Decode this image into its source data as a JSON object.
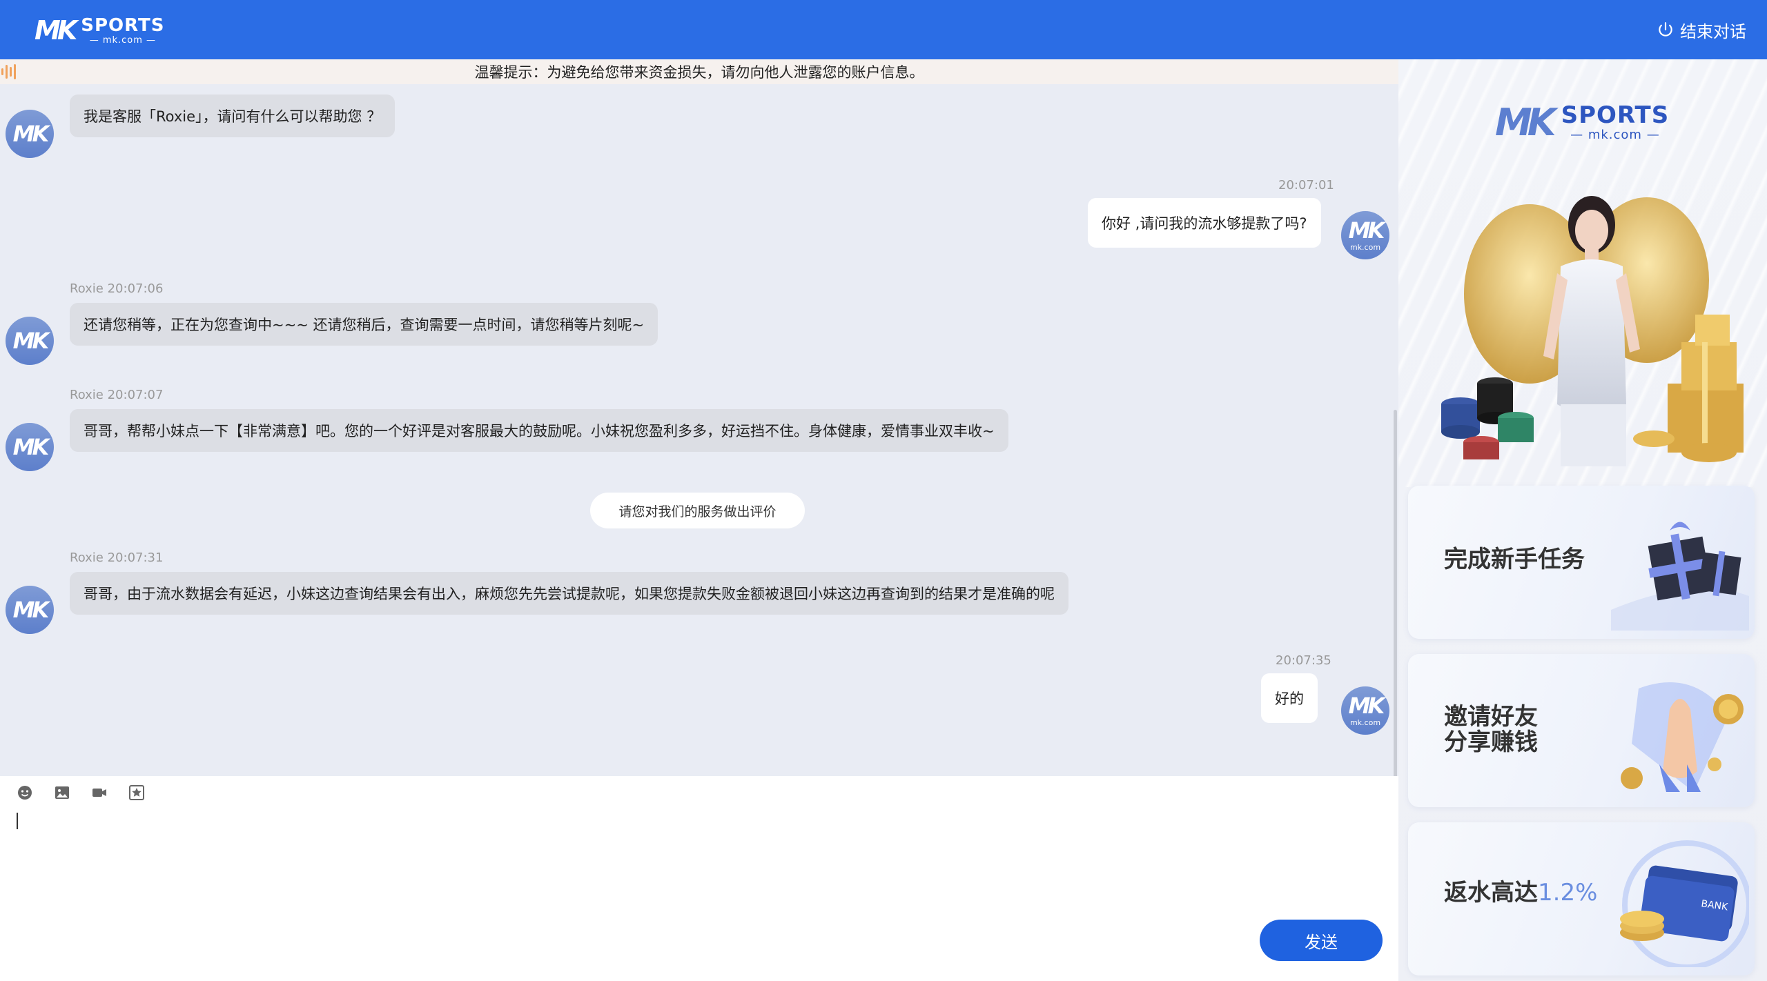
{
  "header": {
    "brand_mk": "MK",
    "brand_sports": "SPORTS",
    "brand_domain": "— mk.com —",
    "end_chat_label": "结束对话"
  },
  "notice": {
    "text": "温馨提示：为避免给您带来资金损失，请勿向他人泄露您的账户信息。"
  },
  "avatars": {
    "agent_mark": "MK",
    "user_mark": "MK",
    "user_domain": "mk.com"
  },
  "messages": [
    {
      "side": "agent",
      "text": "我是客服「Roxie」，请问有什么可以帮助您 ？"
    },
    {
      "side": "user",
      "meta": "20:07:01",
      "text": "你好 ,请问我的流水够提款了吗?"
    },
    {
      "side": "agent",
      "meta": "Roxie 20:07:06",
      "text": "还请您稍等，正在为您查询中~~~  还请您稍后，查询需要一点时间，请您稍等片刻呢~"
    },
    {
      "side": "agent",
      "meta": "Roxie 20:07:07",
      "text": "哥哥，帮帮小妹点一下【非常满意】吧。您的一个好评是对客服最大的鼓励呢。小妹祝您盈利多多，好运挡不住。身体健康，爱情事业双丰收~"
    },
    {
      "side": "agent",
      "meta": "Roxie 20:07:31",
      "text": "哥哥，由于流水数据会有延迟，小妹这边查询结果会有出入，麻烦您先先尝试提款呢，如果您提款失败金额被退回小妹这边再查询到的结果才是准确的呢"
    },
    {
      "side": "user",
      "meta": "20:07:35",
      "text": "好的"
    }
  ],
  "rate_service_label": "请您对我们的服务做出评价",
  "composer": {
    "tools": [
      "emoji-icon",
      "image-icon",
      "video-icon",
      "rating-icon"
    ],
    "input_value": "",
    "send_label": "发送"
  },
  "side_panel": {
    "logo_mk": "MK",
    "logo_sports": "SPORTS",
    "logo_domain": "— mk.com —",
    "promos": [
      {
        "title": "完成新手任务"
      },
      {
        "title_line1": "邀请好友",
        "title_line2": "分享赚钱"
      },
      {
        "title": "返水高达",
        "accent": "1.2%"
      }
    ]
  },
  "colors": {
    "header_blue": "#2b6de5",
    "send_blue": "#1f62e0",
    "chat_bg": "#e9ecf4",
    "agent_bubble": "#dcdee4",
    "user_bubble": "#ffffff",
    "accent": "#6a8ee0"
  }
}
